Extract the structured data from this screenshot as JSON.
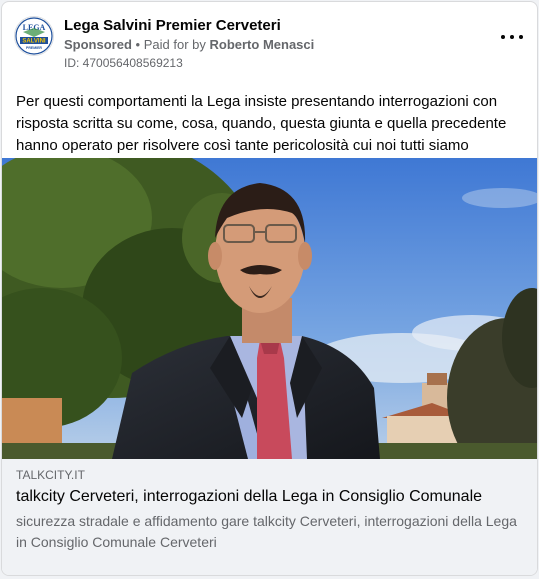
{
  "post": {
    "page_name": "Lega Salvini Premier Cerveteri",
    "sponsored_label": "Sponsored",
    "separator": "•",
    "paid_for_label": "Paid for by",
    "payer": "Roberto Menasci",
    "ad_id": "ID: 470056408569213",
    "body_text": "Per questi comportamenti la Lega insiste presentando interrogazioni con risposta scritta su come, cosa, quando, questa giunta e quella precedente hanno operato per risolvere così tante pericolosità cui noi tutti siamo esposti!!!",
    "more_icon": "more-horizontal-icon"
  },
  "avatar": {
    "logo_text_top": "LEGA",
    "logo_text_banner": "SALVINI",
    "logo_text_bottom": "PREMIER",
    "colors": {
      "blue": "#1d4f9c",
      "yellow": "#f2c500",
      "green": "#2e8b3d"
    }
  },
  "link": {
    "domain": "TALKCITY.IT",
    "title": "talkcity Cerveteri, interrogazioni della Lega in Consiglio Comunale",
    "description": "sicurezza stradale e affidamento gare talkcity Cerveteri, interrogazioni della Lega in Consiglio Comunale Cerveteri"
  },
  "colors": {
    "text_primary": "#050505",
    "text_secondary": "#65676b",
    "link_background": "#f0f2f5",
    "card_background": "#ffffff"
  }
}
